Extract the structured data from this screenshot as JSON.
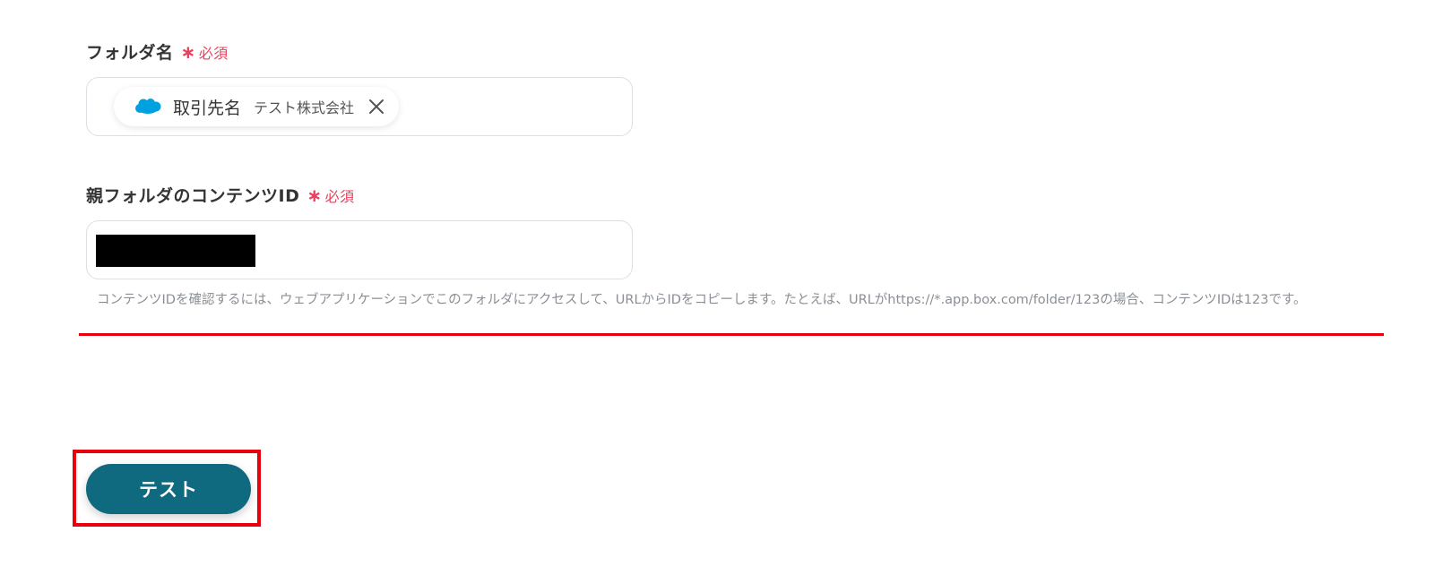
{
  "form": {
    "folder_name": {
      "label": "フォルダ名",
      "required_mark": "∗",
      "required_text": "必須",
      "chip": {
        "icon": "salesforce-cloud-icon",
        "label": "取引先名",
        "value": "テスト株式会社",
        "close_icon": "close-icon"
      }
    },
    "parent_folder_id": {
      "label": "親フォルダのコンテンツID",
      "required_mark": "∗",
      "required_text": "必須",
      "value": "",
      "value_redacted": true,
      "help": "コンテンツIDを確認するには、ウェブアプリケーションでこのフォルダにアクセスして、URLからIDをコピーします。たとえば、URLがhttps://*.app.box.com/folder/123の場合、コンテンツIDは123です。"
    },
    "test_button_label": "テスト"
  },
  "colors": {
    "accent": "#0f6a80",
    "required": "#e8425e",
    "annotation_red": "#e8000d",
    "salesforce_blue": "#00a1e0",
    "help_text": "#8a8f96"
  }
}
